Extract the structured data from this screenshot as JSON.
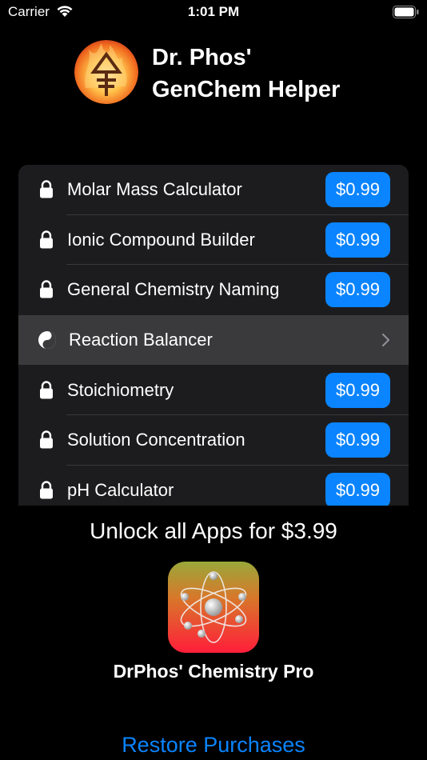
{
  "status_bar": {
    "carrier": "Carrier",
    "time": "1:01 PM"
  },
  "header": {
    "title_line1": "Dr. Phos'",
    "title_line2": "GenChem Helper"
  },
  "list": {
    "items": [
      {
        "label": "Molar Mass Calculator",
        "price": "$0.99",
        "locked": true
      },
      {
        "label": "Ionic Compound Builder",
        "price": "$0.99",
        "locked": true
      },
      {
        "label": "General Chemistry Naming",
        "price": "$0.99",
        "locked": true
      },
      {
        "label": "Reaction Balancer",
        "price": "",
        "locked": false
      },
      {
        "label": "Stoichiometry",
        "price": "$0.99",
        "locked": true
      },
      {
        "label": "Solution Concentration",
        "price": "$0.99",
        "locked": true
      },
      {
        "label": "pH Calculator",
        "price": "$0.99",
        "locked": true
      }
    ]
  },
  "promo": {
    "unlock_text": "Unlock all Apps for $3.99",
    "pro_app_name": "DrPhos' Chemistry Pro"
  },
  "footer": {
    "restore_label": "Restore Purchases"
  },
  "colors": {
    "accent": "#0a84ff",
    "list_background": "#1c1c1e",
    "selected_row": "#3a3a3c"
  }
}
